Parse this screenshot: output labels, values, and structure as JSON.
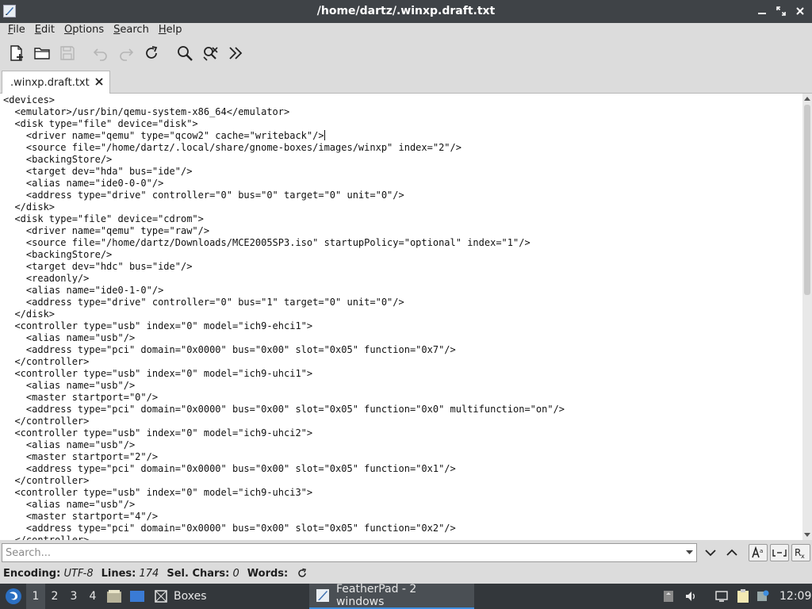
{
  "window": {
    "title": "/home/dartz/.winxp.draft.txt"
  },
  "menu": {
    "items": [
      {
        "underline": "F",
        "rest": "ile"
      },
      {
        "underline": "E",
        "rest": "dit"
      },
      {
        "underline": "O",
        "rest": "ptions"
      },
      {
        "underline": "S",
        "rest": "earch"
      },
      {
        "underline": "H",
        "rest": "elp"
      }
    ]
  },
  "toolbar": {
    "icons": [
      "new-document-icon",
      "open-folder-icon",
      "save-icon",
      "undo-icon",
      "redo-icon",
      "reload-icon",
      "find-icon",
      "replace-icon",
      "go-to-line-icon"
    ]
  },
  "tab": {
    "label": ".winxp.draft.txt"
  },
  "editor": {
    "lines": [
      "<devices>",
      "  <emulator>/usr/bin/qemu-system-x86_64</emulator>",
      "  <disk type=\"file\" device=\"disk\">",
      "    <driver name=\"qemu\" type=\"qcow2\" cache=\"writeback\"/>",
      "    <source file=\"/home/dartz/.local/share/gnome-boxes/images/winxp\" index=\"2\"/>",
      "    <backingStore/>",
      "    <target dev=\"hda\" bus=\"ide\"/>",
      "    <alias name=\"ide0-0-0\"/>",
      "    <address type=\"drive\" controller=\"0\" bus=\"0\" target=\"0\" unit=\"0\"/>",
      "  </disk>",
      "  <disk type=\"file\" device=\"cdrom\">",
      "    <driver name=\"qemu\" type=\"raw\"/>",
      "    <source file=\"/home/dartz/Downloads/MCE2005SP3.iso\" startupPolicy=\"optional\" index=\"1\"/>",
      "    <backingStore/>",
      "    <target dev=\"hdc\" bus=\"ide\"/>",
      "    <readonly/>",
      "    <alias name=\"ide0-1-0\"/>",
      "    <address type=\"drive\" controller=\"0\" bus=\"1\" target=\"0\" unit=\"0\"/>",
      "  </disk>",
      "  <controller type=\"usb\" index=\"0\" model=\"ich9-ehci1\">",
      "    <alias name=\"usb\"/>",
      "    <address type=\"pci\" domain=\"0x0000\" bus=\"0x00\" slot=\"0x05\" function=\"0x7\"/>",
      "  </controller>",
      "  <controller type=\"usb\" index=\"0\" model=\"ich9-uhci1\">",
      "    <alias name=\"usb\"/>",
      "    <master startport=\"0\"/>",
      "    <address type=\"pci\" domain=\"0x0000\" bus=\"0x00\" slot=\"0x05\" function=\"0x0\" multifunction=\"on\"/>",
      "  </controller>",
      "  <controller type=\"usb\" index=\"0\" model=\"ich9-uhci2\">",
      "    <alias name=\"usb\"/>",
      "    <master startport=\"2\"/>",
      "    <address type=\"pci\" domain=\"0x0000\" bus=\"0x00\" slot=\"0x05\" function=\"0x1\"/>",
      "  </controller>",
      "  <controller type=\"usb\" index=\"0\" model=\"ich9-uhci3\">",
      "    <alias name=\"usb\"/>",
      "    <master startport=\"4\"/>",
      "    <address type=\"pci\" domain=\"0x0000\" bus=\"0x00\" slot=\"0x05\" function=\"0x2\"/>",
      "  </controller>"
    ],
    "caret_line": 3
  },
  "search": {
    "placeholder": "Search...",
    "value": ""
  },
  "status": {
    "encoding_label": "Encoding:",
    "encoding_value": "UTF-8",
    "lines_label": "Lines:",
    "lines_value": "174",
    "selchars_label": "Sel. Chars:",
    "selchars_value": "0",
    "words_label": "Words:"
  },
  "taskbar": {
    "workspaces": [
      "1",
      "2",
      "3",
      "4"
    ],
    "active_workspace": "1",
    "boxes_label": "Boxes",
    "featherpad_label": "FeatherPad - 2 windows",
    "clock": "12:09"
  },
  "colors": {
    "titlebar_bg": "#3f4347",
    "taskbar_bg": "#33373b",
    "accent": "#3d8ee0"
  }
}
